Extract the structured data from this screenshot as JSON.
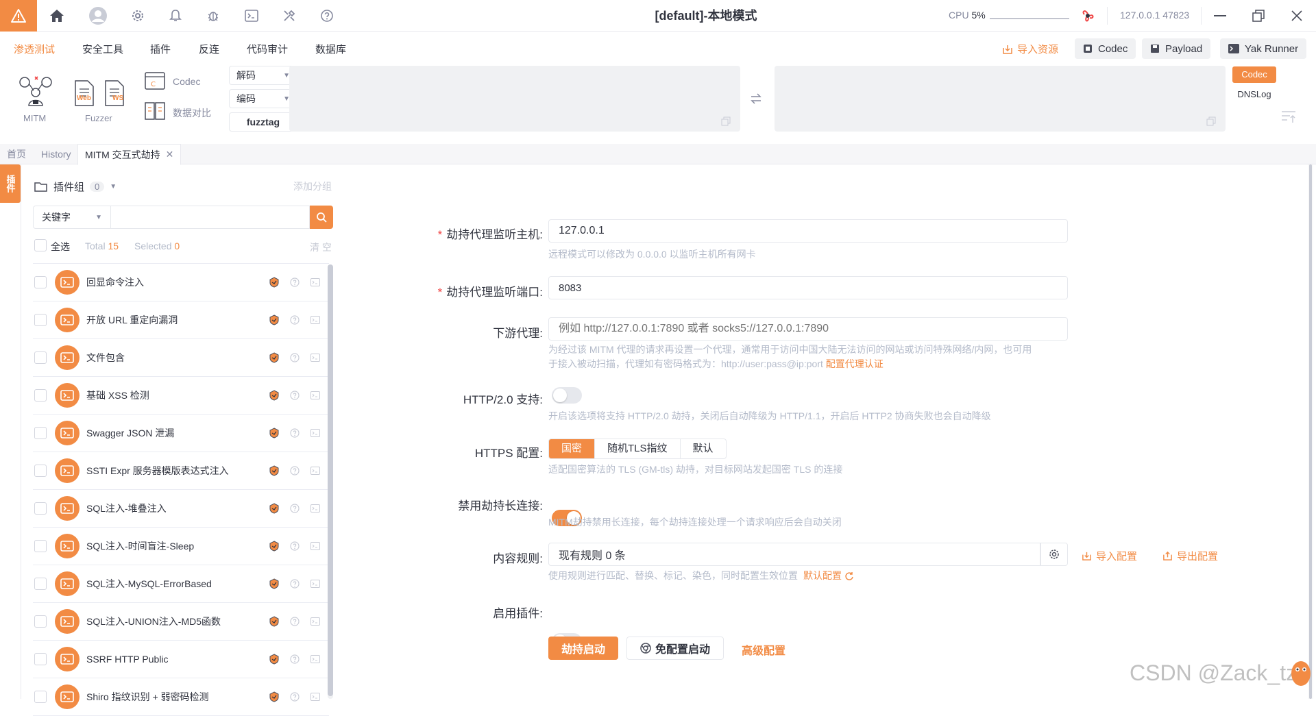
{
  "titlebar": {
    "title": "[default]-本地模式",
    "cpu_label": "CPU",
    "cpu_value": "5%",
    "address": "127.0.0.1 47823"
  },
  "menu": {
    "items": [
      "渗透测试",
      "安全工具",
      "插件",
      "反连",
      "代码审计",
      "数据库"
    ],
    "active_index": 0,
    "import_label": "导入资源",
    "codec_label": "Codec",
    "payload_label": "Payload",
    "runner_label": "Yak Runner"
  },
  "toolbar": {
    "mitm_label": "MITM",
    "fuzzer_label": "Fuzzer",
    "web_tag": "Web",
    "ws_tag": "WS",
    "codec_label": "Codec",
    "diff_label": "数据对比",
    "decode_label": "解码",
    "encode_label": "编码",
    "fuzztag_label": "fuzztag",
    "side_codec": "Codec",
    "side_dnslog": "DNSLog"
  },
  "tabs": {
    "home": "首页",
    "history": "History",
    "mitm": "MITM 交互式劫持"
  },
  "sidebar": {
    "vertical_tab": "插件"
  },
  "plugins": {
    "group_label": "插件组",
    "group_count": "0",
    "add_group": "添加分组",
    "keyword_label": "关键字",
    "search_placeholder": "",
    "select_all": "全选",
    "total_label": "Total",
    "total_value": "15",
    "selected_label": "Selected",
    "selected_value": "0",
    "clear_label": "清 空",
    "items": [
      "回显命令注入",
      "开放 URL 重定向漏洞",
      "文件包含",
      "基础 XSS 检测",
      "Swagger JSON 泄漏",
      "SSTI Expr 服务器模版表达式注入",
      "SQL注入-堆叠注入",
      "SQL注入-时间盲注-Sleep",
      "SQL注入-MySQL-ErrorBased",
      "SQL注入-UNION注入-MD5函数",
      "SSRF HTTP Public",
      "Shiro 指纹识别 + 弱密码检测"
    ]
  },
  "form": {
    "host_label": "劫持代理监听主机:",
    "host_value": "127.0.0.1",
    "host_help": "远程模式可以修改为 0.0.0.0 以监听主机所有网卡",
    "port_label": "劫持代理监听端口:",
    "port_value": "8083",
    "downstream_label": "下游代理:",
    "downstream_placeholder": "例如 http://127.0.0.1:7890 或者 socks5://127.0.0.1:7890",
    "downstream_help1": "为经过该 MITM 代理的请求再设置一个代理，通常用于访问中国大陆无法访问的网站或访问特殊网络/内网，也可用",
    "downstream_help2": "于接入被动扫描，代理如有密码格式为：http://user:pass@ip:port",
    "downstream_link": "配置代理认证",
    "http2_label": "HTTP/2.0 支持:",
    "http2_help": "开启该选项将支持 HTTP/2.0 劫持，关闭后自动降级为 HTTP/1.1，开启后 HTTP2 协商失败也会自动降级",
    "http2_on": false,
    "https_label": "HTTPS 配置:",
    "https_options": [
      "国密",
      "随机TLS指纹",
      "默认"
    ],
    "https_selected": 0,
    "https_help": "适配国密算法的 TLS (GM-tls) 劫持，对目标网站发起国密 TLS 的连接",
    "keepalive_label": "禁用劫持长连接:",
    "keepalive_on": true,
    "keepalive_help": "MITM劫持禁用长连接，每个劫持连接处理一个请求响应后会自动关闭",
    "rules_label": "内容规则:",
    "rules_value": "现有规则 0 条",
    "rules_import": "导入配置",
    "rules_export": "导出配置",
    "rules_help": "使用规则进行匹配、替换、标记、染色，同时配置生效位置",
    "rules_default": "默认配置",
    "plugin_label": "启用插件:",
    "plugin_on": false,
    "start_button": "劫持启动",
    "noconf_button": "免配置启动",
    "advanced_button": "高级配置"
  },
  "watermark": "CSDN @Zack_tz",
  "colors": {
    "accent": "#f28b44",
    "text": "#31343f",
    "muted": "#85899e",
    "help": "#b4bbca"
  }
}
